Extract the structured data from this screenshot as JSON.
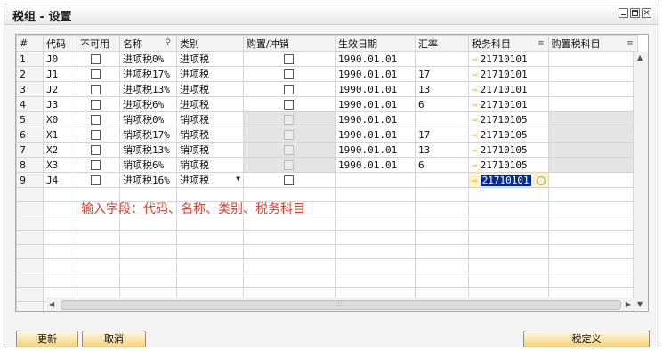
{
  "window": {
    "title": "税组 - 设置"
  },
  "columns": [
    "#",
    "代码",
    "不可用",
    "名称",
    "类别",
    "购置/冲销",
    "生效日期",
    "汇率",
    "税务科目",
    "购置税科目"
  ],
  "rows": [
    {
      "num": "1",
      "code": "J0",
      "name": "进项税0%",
      "category": "进项税",
      "date": "1990.01.01",
      "rate": "",
      "account": "21710101",
      "gray": false
    },
    {
      "num": "2",
      "code": "J1",
      "name": "进项税17%",
      "category": "进项税",
      "date": "1990.01.01",
      "rate": "17",
      "account": "21710101",
      "gray": false
    },
    {
      "num": "3",
      "code": "J2",
      "name": "进项税13%",
      "category": "进项税",
      "date": "1990.01.01",
      "rate": "13",
      "account": "21710101",
      "gray": false
    },
    {
      "num": "4",
      "code": "J3",
      "name": "进项税6%",
      "category": "进项税",
      "date": "1990.01.01",
      "rate": "6",
      "account": "21710101",
      "gray": false
    },
    {
      "num": "5",
      "code": "X0",
      "name": "销项税0%",
      "category": "销项税",
      "date": "1990.01.01",
      "rate": "",
      "account": "21710105",
      "gray": true
    },
    {
      "num": "6",
      "code": "X1",
      "name": "销项税17%",
      "category": "销项税",
      "date": "1990.01.01",
      "rate": "17",
      "account": "21710105",
      "gray": true
    },
    {
      "num": "7",
      "code": "X2",
      "name": "销项税13%",
      "category": "销项税",
      "date": "1990.01.01",
      "rate": "13",
      "account": "21710105",
      "gray": true
    },
    {
      "num": "8",
      "code": "X3",
      "name": "销项税6%",
      "category": "销项税",
      "date": "1990.01.01",
      "rate": "6",
      "account": "21710105",
      "gray": true
    },
    {
      "num": "9",
      "code": "J4",
      "name": "进项税16%",
      "category": "进项税",
      "date": "",
      "rate": "",
      "account": "21710101",
      "gray": false,
      "selected": true
    }
  ],
  "annotation": "输入字段：代码、名称、类别、税务科目",
  "buttons": {
    "update": "更新",
    "cancel": "取消",
    "tax_definition": "税定义"
  },
  "colors": {
    "button_top": "#fff8e2",
    "button_bottom": "#f8d27a",
    "annotation": "#d8422c",
    "selection": "#0b2b8a"
  },
  "icons": {
    "account_link": "arrow-right-icon",
    "menu": "list-icon"
  }
}
